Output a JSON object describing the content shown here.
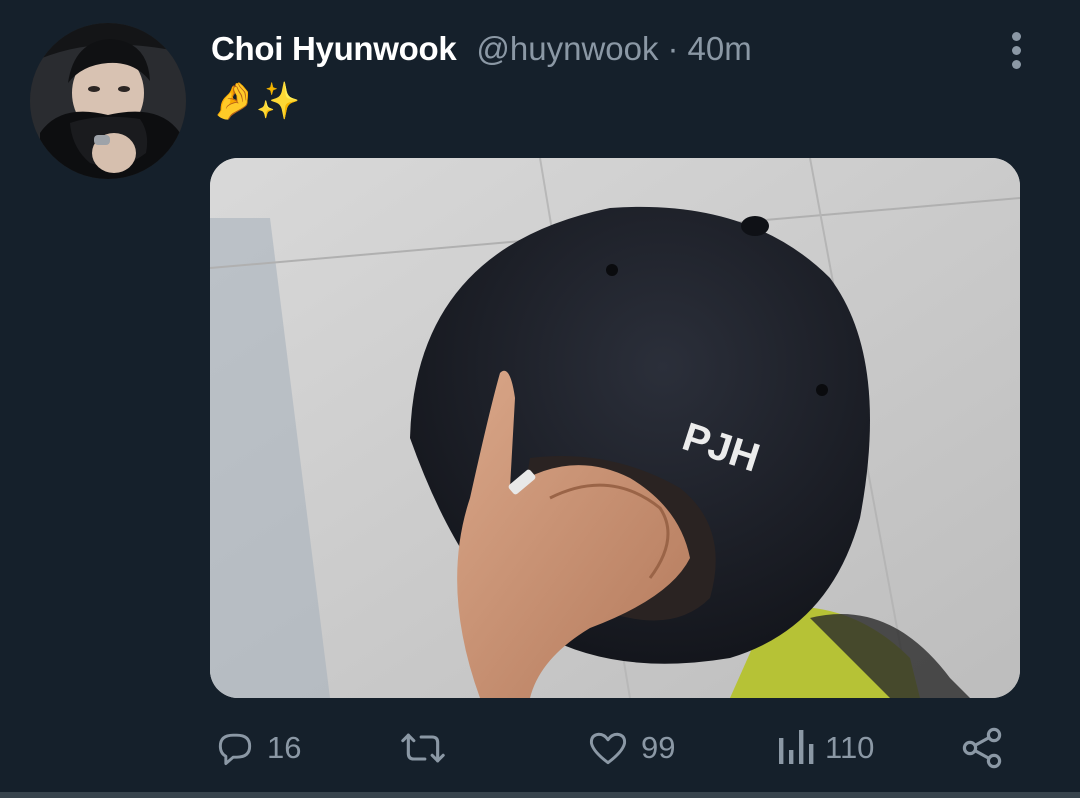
{
  "tweet": {
    "display_name": "Choi Hyunwook",
    "handle": "@huynwook",
    "separator": "·",
    "time": "40m",
    "text": "🤌✨",
    "media": {
      "embroidery_text": "PJH"
    }
  },
  "actions": {
    "reply": {
      "icon": "reply-icon",
      "count": "16"
    },
    "retweet": {
      "icon": "retweet-icon",
      "count": ""
    },
    "like": {
      "icon": "heart-icon",
      "count": "99"
    },
    "views": {
      "icon": "views-icon",
      "count": "110"
    },
    "share": {
      "icon": "share-icon",
      "count": ""
    }
  },
  "colors": {
    "background": "#15202b",
    "text_primary": "#ffffff",
    "text_secondary": "#8b98a5",
    "divider": "#38444d"
  }
}
